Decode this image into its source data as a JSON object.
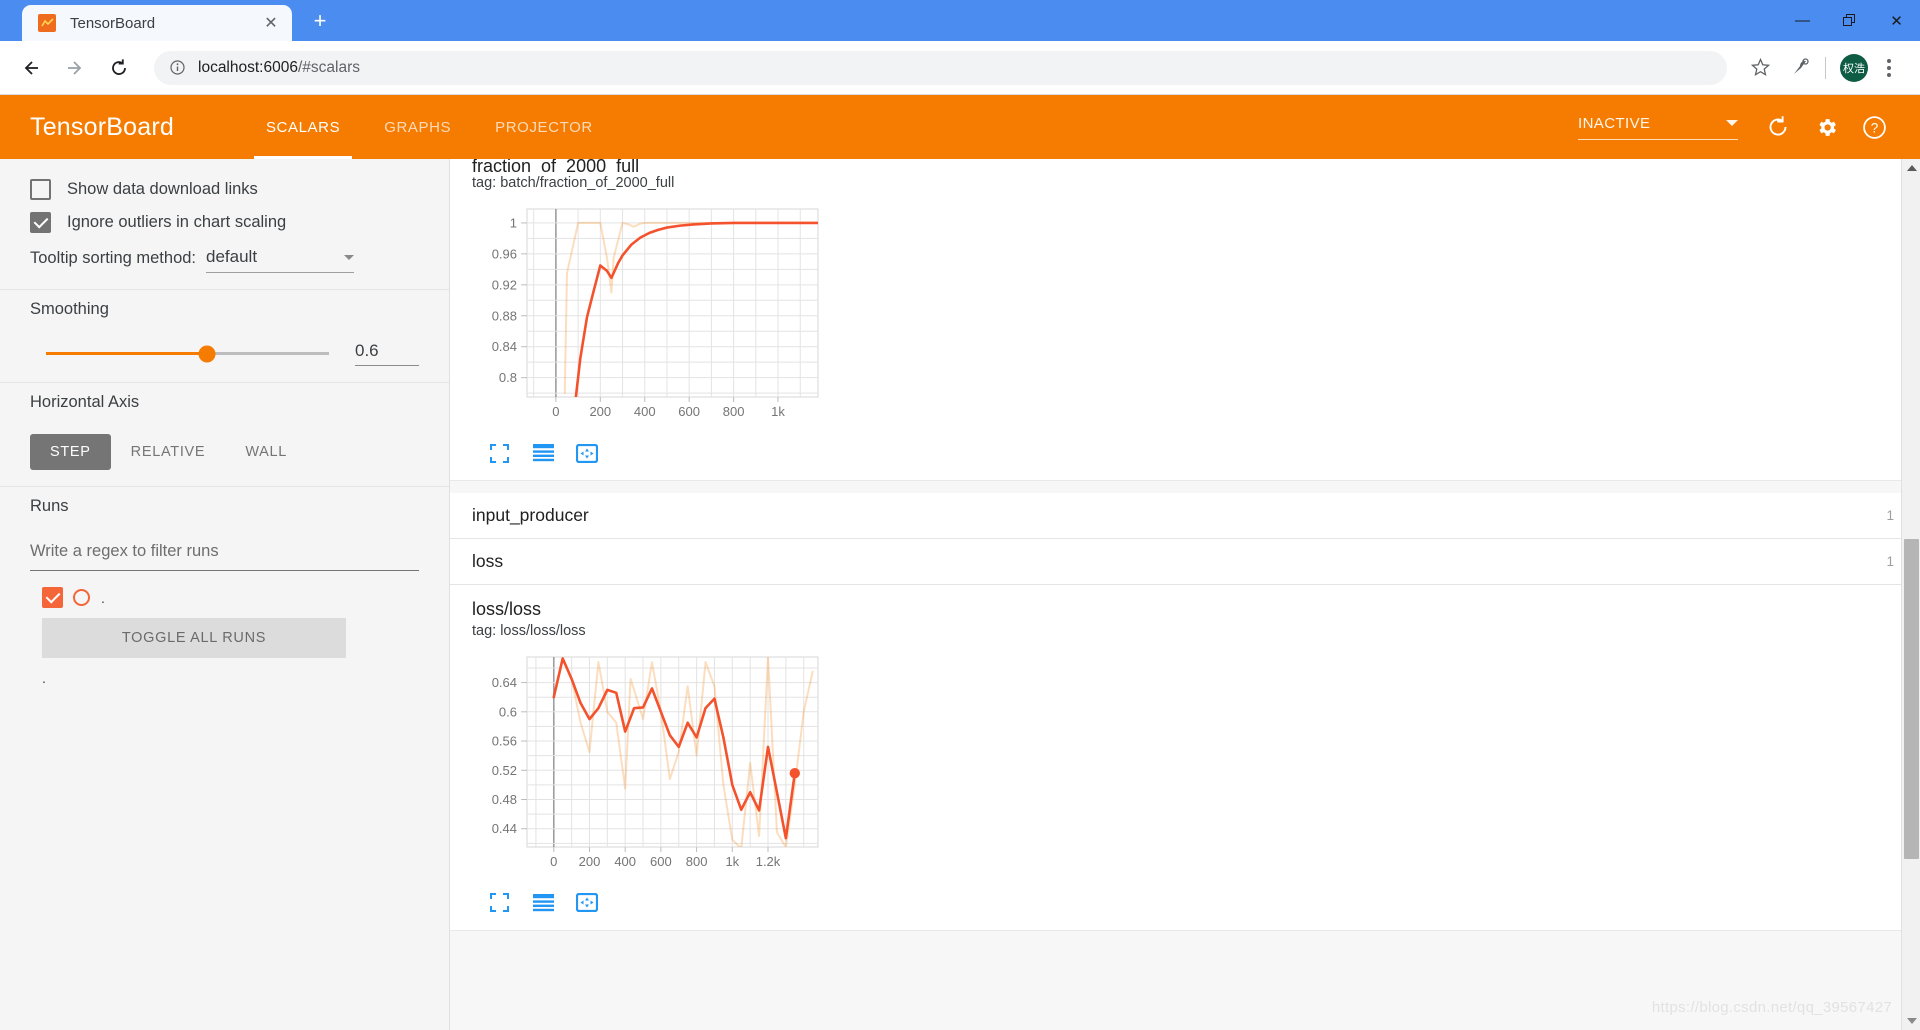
{
  "browser": {
    "tab_title": "TensorBoard",
    "favicon_name": "tensorboard-favicon",
    "close_tab_glyph": "✕",
    "new_tab_glyph": "+",
    "back_glyph": "←",
    "forward_glyph": "→",
    "reload_glyph": "⟳",
    "info_glyph": "ⓘ",
    "url_host": "localhost:6006",
    "url_path": "/#scalars",
    "star_glyph": "☆",
    "avatar_initials": "权浩",
    "minimize_glyph": "—",
    "maximize_glyph": "❐",
    "close_glyph": "✕"
  },
  "tb_header": {
    "brand": "TensorBoard",
    "tabs": [
      {
        "label": "SCALARS",
        "active": true
      },
      {
        "label": "GRAPHS",
        "active": false
      },
      {
        "label": "PROJECTOR",
        "active": false
      }
    ],
    "status_select_value": "INACTIVE",
    "reload_glyph": "⟳",
    "settings_glyph": "⚙",
    "help_glyph": "?"
  },
  "sidebar": {
    "show_download_links": {
      "label": "Show data download links",
      "checked": false
    },
    "ignore_outliers": {
      "label": "Ignore outliers in chart scaling",
      "checked": true
    },
    "tooltip_sorting": {
      "label": "Tooltip sorting method:",
      "value": "default"
    },
    "smoothing": {
      "label": "Smoothing",
      "value": "0.6",
      "percent": 57
    },
    "horizontal_axis": {
      "label": "Horizontal Axis",
      "options": [
        {
          "label": "STEP",
          "active": true
        },
        {
          "label": "RELATIVE",
          "active": false
        },
        {
          "label": "WALL",
          "active": false
        }
      ]
    },
    "runs": {
      "label": "Runs",
      "filter_placeholder": "Write a regex to filter runs",
      "filter_value": "",
      "run_item_label": ".",
      "toggle_all_label": "TOGGLE ALL RUNS",
      "trailing_label": "."
    }
  },
  "main": {
    "groups": [
      {
        "name": "input_producer",
        "count": "1"
      },
      {
        "name": "loss",
        "count": "1"
      }
    ],
    "chart_toolbar": {
      "expand_icon": "expand-chart-icon",
      "lines_icon": "toggle-y-axis-icon",
      "fit_icon": "fit-domain-icon"
    },
    "watermark": "https://blog.csdn.net/qq_39567427"
  },
  "chart_data": [
    {
      "type": "line",
      "title": "fraction_of_2000_full",
      "subtitle": "tag: batch/fraction_of_2000_full",
      "xlabel": "",
      "ylabel": "",
      "grid": true,
      "legend": "none",
      "xlim": [
        -130,
        1180
      ],
      "ylim": [
        0.775,
        1.018
      ],
      "xticks": [
        0,
        200,
        400,
        600,
        800,
        1000
      ],
      "xticklabels": [
        "0",
        "200",
        "400",
        "600",
        "800",
        "1k"
      ],
      "yticks": [
        0.8,
        0.84,
        0.88,
        0.92,
        0.96,
        1.0
      ],
      "yticklabels": [
        "0.8",
        "0.84",
        "0.88",
        "0.92",
        "0.96",
        "1"
      ],
      "series": [
        {
          "name": "raw",
          "color": "#f57c00",
          "opacity": 0.25,
          "x": [
            40,
            50,
            100,
            150,
            200,
            230,
            250,
            260,
            300,
            330,
            350,
            380,
            400,
            500,
            600,
            700,
            800,
            900,
            1000,
            1100,
            1180
          ],
          "y": [
            0.78,
            0.935,
            1.0,
            1.0,
            1.0,
            0.955,
            0.91,
            0.955,
            1.0,
            0.998,
            0.995,
            0.999,
            1.0,
            1.0,
            1.0,
            1.0,
            1.0,
            1.0,
            1.0,
            1.0,
            1.0
          ]
        },
        {
          "name": "smoothed",
          "color": "#f4522d",
          "opacity": 1,
          "x": [
            90,
            110,
            140,
            170,
            200,
            230,
            250,
            280,
            300,
            340,
            380,
            420,
            460,
            500,
            560,
            620,
            700,
            800,
            900,
            1000,
            1100,
            1180
          ],
          "y": [
            0.775,
            0.825,
            0.878,
            0.912,
            0.945,
            0.938,
            0.929,
            0.948,
            0.958,
            0.972,
            0.981,
            0.987,
            0.991,
            0.994,
            0.9965,
            0.998,
            0.9993,
            1.0,
            1.0,
            1.0,
            1.0,
            1.0
          ]
        }
      ]
    },
    {
      "type": "line",
      "title": "loss/loss",
      "subtitle": "tag: loss/loss/loss",
      "xlabel": "",
      "ylabel": "",
      "grid": true,
      "legend": "none",
      "xlim": [
        -150,
        1480
      ],
      "ylim": [
        0.415,
        0.675
      ],
      "xticks": [
        0,
        200,
        400,
        600,
        800,
        1000,
        1200
      ],
      "xticklabels": [
        "0",
        "200",
        "400",
        "600",
        "800",
        "1k",
        "1.2k"
      ],
      "yticks": [
        0.44,
        0.48,
        0.52,
        0.56,
        0.6,
        0.64
      ],
      "yticklabels": [
        "0.44",
        "0.48",
        "0.52",
        "0.56",
        "0.6",
        "0.64"
      ],
      "endpoint": {
        "x": 1350,
        "y": 0.516
      },
      "series": [
        {
          "name": "raw",
          "color": "#f57c00",
          "opacity": 0.25,
          "x": [
            0,
            50,
            100,
            150,
            200,
            250,
            300,
            350,
            400,
            430,
            450,
            500,
            550,
            600,
            650,
            700,
            750,
            800,
            850,
            900,
            950,
            1000,
            1050,
            1100,
            1150,
            1200,
            1250,
            1300,
            1350,
            1400,
            1450
          ],
          "y": [
            0.62,
            0.672,
            0.645,
            0.585,
            0.545,
            0.668,
            0.6,
            0.585,
            0.495,
            0.645,
            0.63,
            0.59,
            0.668,
            0.6,
            0.508,
            0.545,
            0.635,
            0.54,
            0.668,
            0.635,
            0.5,
            0.425,
            0.413,
            0.53,
            0.43,
            0.675,
            0.435,
            0.415,
            0.5,
            0.6,
            0.655
          ]
        },
        {
          "name": "smoothed",
          "color": "#f4522d",
          "opacity": 1,
          "x": [
            0,
            50,
            100,
            150,
            200,
            250,
            300,
            350,
            400,
            450,
            500,
            550,
            600,
            650,
            700,
            750,
            800,
            850,
            900,
            950,
            1000,
            1050,
            1100,
            1150,
            1200,
            1250,
            1300,
            1350
          ],
          "y": [
            0.62,
            0.673,
            0.645,
            0.612,
            0.59,
            0.605,
            0.63,
            0.626,
            0.573,
            0.605,
            0.606,
            0.632,
            0.6,
            0.568,
            0.552,
            0.585,
            0.565,
            0.605,
            0.618,
            0.565,
            0.5,
            0.466,
            0.49,
            0.465,
            0.552,
            0.49,
            0.427,
            0.516
          ]
        }
      ]
    }
  ]
}
